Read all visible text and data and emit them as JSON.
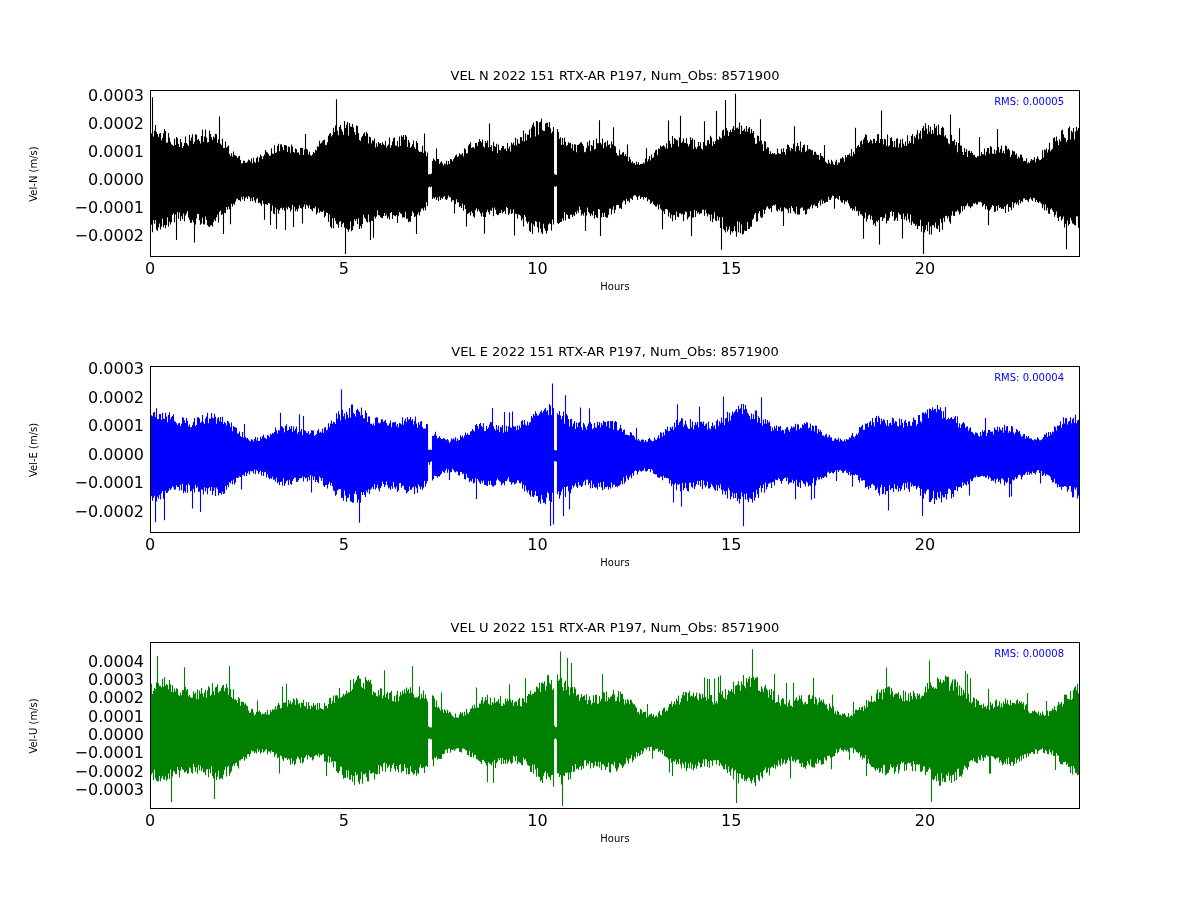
{
  "panels": [
    {
      "title": "VEL N 2022 151 RTX-AR  P197, Num_Obs: 8571900",
      "ylabel": "Vel-N (m/s)",
      "xlabel": "Hours",
      "rms": "RMS:  0.00005",
      "color": "#000000",
      "yticks": [
        "0.0003",
        "0.0002",
        "0.0001",
        "0.0000",
        "−0.0001",
        "−0.0002"
      ],
      "xticks": [
        "0",
        "5",
        "10",
        "15",
        "20"
      ]
    },
    {
      "title": "VEL E 2022 151 RTX-AR  P197, Num_Obs: 8571900",
      "ylabel": "Vel-E (m/s)",
      "xlabel": "Hours",
      "rms": "RMS:  0.00004",
      "color": "#0000ff",
      "yticks": [
        "0.0003",
        "0.0002",
        "0.0001",
        "0.0000",
        "−0.0001",
        "−0.0002"
      ],
      "xticks": [
        "0",
        "5",
        "10",
        "15",
        "20"
      ]
    },
    {
      "title": "VEL U 2022 151 RTX-AR  P197, Num_Obs: 8571900",
      "ylabel": "Vel-U (m/s)",
      "xlabel": "Hours",
      "rms": "RMS:  0.00008",
      "color": "#008000",
      "yticks": [
        "0.0004",
        "0.0003",
        "0.0002",
        "0.0001",
        "0.0000",
        "−0.0001",
        "−0.0002",
        "−0.0003"
      ],
      "xticks": [
        "0",
        "5",
        "10",
        "15",
        "20"
      ]
    }
  ]
}
